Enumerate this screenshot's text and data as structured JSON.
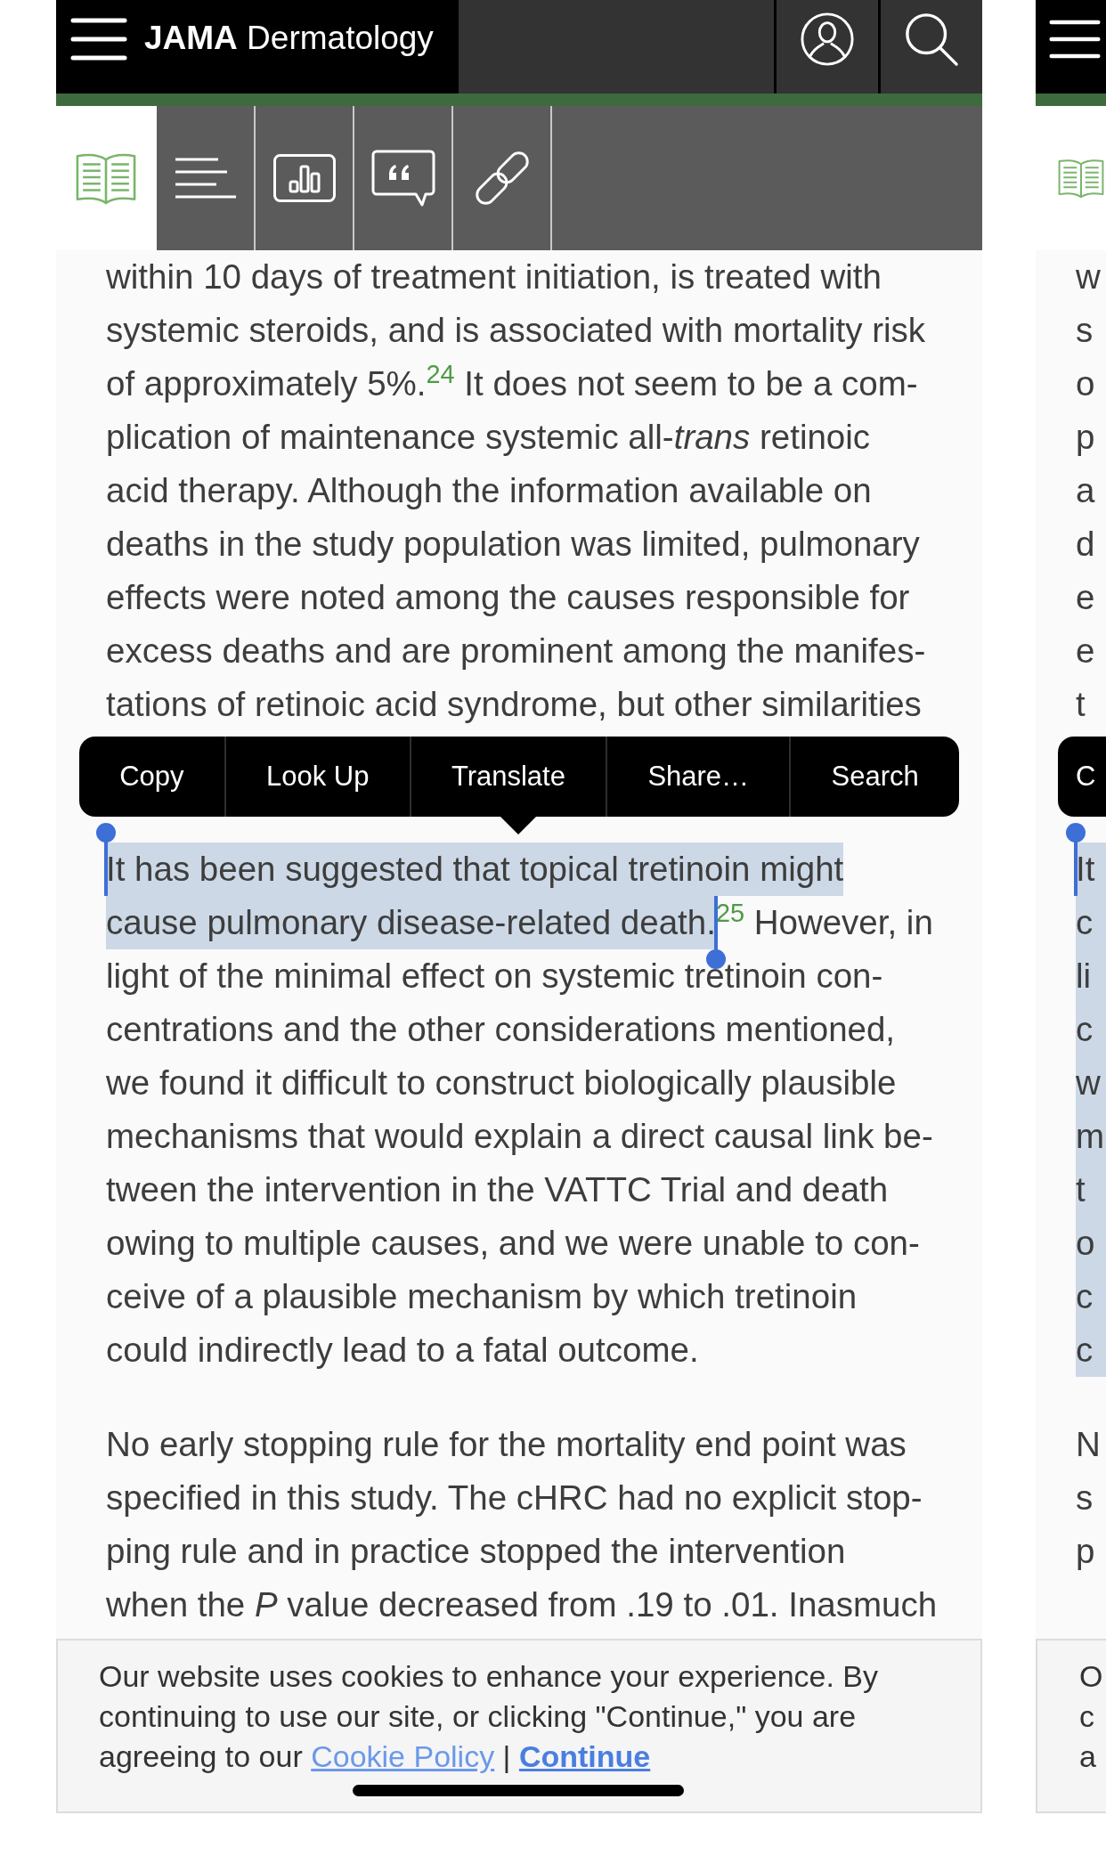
{
  "header": {
    "title": "**JAMA** Dermatology",
    "actions": [
      {
        "kind": "profile"
      },
      {
        "kind": "search"
      }
    ]
  },
  "toolbar": {
    "items": [
      {
        "kind": "article",
        "selected": true
      },
      {
        "kind": "outline",
        "selected": false
      },
      {
        "kind": "figures",
        "selected": false
      },
      {
        "kind": "cite",
        "selected": false
      },
      {
        "kind": "link",
        "selected": false
      }
    ]
  },
  "article": {
    "paragraphs": [
      {
        "lines": [
          {
            "text": "within 10 days of treatment initiation, is treated with",
            "selected": false
          },
          {
            "text": "systemic steroids, and is associated with mortality risk",
            "selected": false
          },
          {
            "text": "of approximately 5%.$^{24}$ It does not seem to be a com-",
            "selected": false
          },
          {
            "text": "plication of maintenance systemic all-*trans* retinoic",
            "selected": false
          },
          {
            "text": "acid therapy. Although the information available on",
            "selected": false
          },
          {
            "text": "deaths in the study population was limited, pulmonary",
            "selected": false
          },
          {
            "text": "effects were noted among the causes responsible for",
            "selected": false
          },
          {
            "text": "excess deaths and are prominent among the manifes-",
            "selected": false
          },
          {
            "text": "tations of retinoic acid syndrome, but other similarities",
            "selected": false
          }
        ]
      },
      {
        "lines": [
          {
            "text": "It has been suggested that topical tretinoin might",
            "selected": true
          },
          {
            "text": "cause pulmonary disease-related death.",
            "selected": true,
            "rest": "$^{25}$ However, in"
          },
          {
            "text": "light of the minimal effect on systemic tretinoin con-",
            "selected": false
          },
          {
            "text": "centrations and the other considerations mentioned,",
            "selected": false
          },
          {
            "text": "we found it difficult to construct biologically plausible",
            "selected": false
          },
          {
            "text": "mechanisms that would explain a direct causal link be-",
            "selected": false
          },
          {
            "text": "tween the intervention in the VATTC Trial and death",
            "selected": false
          },
          {
            "text": "owing to multiple causes, and we were unable to con-",
            "selected": false
          },
          {
            "text": "ceive of a plausible mechanism by which tretinoin",
            "selected": false
          },
          {
            "text": "could indirectly lead to a fatal outcome.",
            "selected": false
          }
        ]
      },
      {
        "lines": [
          {
            "text": "No early stopping rule for the mortality end point was",
            "selected": false
          },
          {
            "text": "specified in this study. The cHRC had no explicit stop-",
            "selected": false
          },
          {
            "text": "ping rule and in practice stopped the intervention",
            "selected": false
          },
          {
            "text": "when the *P* value decreased from .19 to .01. Inasmuch",
            "selected": false
          }
        ]
      }
    ]
  },
  "context_menu": {
    "items": [
      "Copy",
      "Look Up",
      "Translate",
      "Share…",
      "Search"
    ]
  },
  "cookie_banner": {
    "message_lines": [
      "Our website uses cookies to enhance your experience. By",
      "continuing to use our site, or clicking \"Continue,\" you are",
      "agreeing to our"
    ],
    "links": [
      {
        "label": "Cookie Policy",
        "kind": "policy"
      },
      {
        "label": "Continue",
        "kind": "accept"
      }
    ],
    "separator": "|"
  },
  "adjacent_page": {
    "menu_fragment": "C",
    "paragraphs": [
      {
        "lines": [
          {
            "text": "w",
            "selected": false
          },
          {
            "text": "s",
            "selected": false
          },
          {
            "text": "o",
            "selected": false
          },
          {
            "text": "p",
            "selected": false
          },
          {
            "text": "a",
            "selected": false
          },
          {
            "text": "d",
            "selected": false
          },
          {
            "text": "e",
            "selected": false
          },
          {
            "text": "e",
            "selected": false
          },
          {
            "text": "t",
            "selected": false
          }
        ]
      },
      {
        "lines": [
          {
            "text": "It",
            "selected": true
          },
          {
            "text": "c",
            "selected": true
          },
          {
            "text": "li",
            "selected": true
          },
          {
            "text": "c",
            "selected": true
          },
          {
            "text": "w",
            "selected": true
          },
          {
            "text": "m",
            "selected": true
          },
          {
            "text": "t",
            "selected": true
          },
          {
            "text": "o",
            "selected": true
          },
          {
            "text": "c",
            "selected": true
          },
          {
            "text": "c",
            "selected": true
          }
        ]
      },
      {
        "lines": [
          {
            "text": "N",
            "selected": false
          },
          {
            "text": "s",
            "selected": false
          },
          {
            "text": "p",
            "selected": false
          }
        ]
      }
    ],
    "banner_lines": [
      "O",
      "c",
      "a"
    ]
  }
}
